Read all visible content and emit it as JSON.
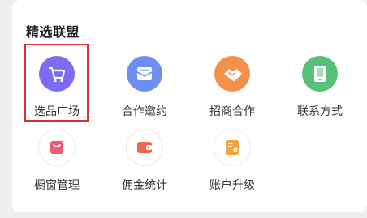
{
  "section": {
    "title": "精选联盟"
  },
  "items": [
    {
      "label": "选品广场",
      "icon": "cart-icon",
      "color": "#7d6bf2"
    },
    {
      "label": "合作邀约",
      "icon": "mail-icon",
      "color": "#6c8ff0"
    },
    {
      "label": "招商合作",
      "icon": "handshake-icon",
      "color": "#f3904a"
    },
    {
      "label": "联系方式",
      "icon": "phone-icon",
      "color": "#57c07a"
    },
    {
      "label": "橱窗管理",
      "icon": "bag-icon",
      "color": "#ef5a72"
    },
    {
      "label": "佣金统计",
      "icon": "wallet-icon",
      "color": "#f26352"
    },
    {
      "label": "账户升级",
      "icon": "certificate-icon",
      "color": "#f2a43a"
    }
  ]
}
